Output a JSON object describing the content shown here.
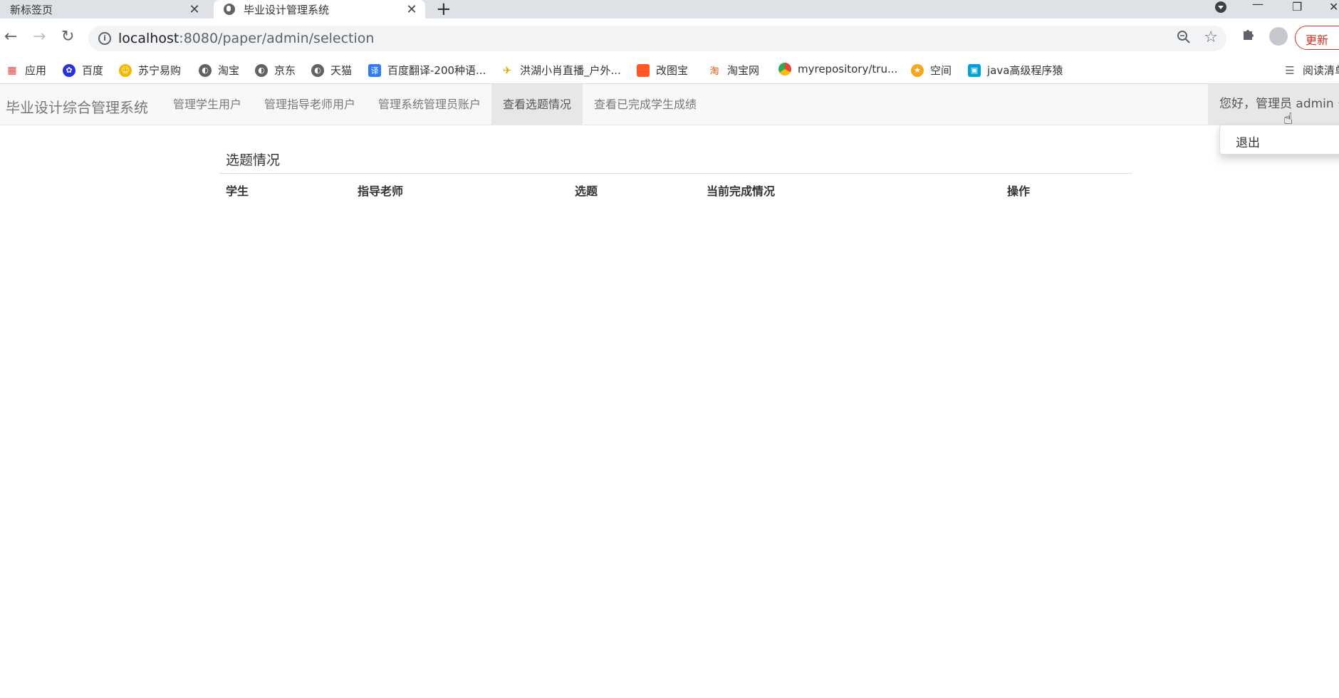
{
  "browser": {
    "tabs": [
      {
        "title": "新标签页",
        "active": false
      },
      {
        "title": "毕业设计管理系统",
        "active": true
      }
    ],
    "url_host": "localhost",
    "url_rest": ":8080/paper/admin/selection",
    "update_label": "更新",
    "bookmarks": [
      {
        "label": "应用",
        "icon": "apps-grid-icon",
        "color": "#e8453c"
      },
      {
        "label": "百度",
        "icon": "baidu-paw-icon",
        "color": "#2932e1"
      },
      {
        "label": "苏宁易购",
        "icon": "suning-icon",
        "color": "#f6b700"
      },
      {
        "label": "淘宝",
        "icon": "globe-icon",
        "color": "#5f6368"
      },
      {
        "label": "京东",
        "icon": "globe-icon",
        "color": "#5f6368"
      },
      {
        "label": "天猫",
        "icon": "globe-icon",
        "color": "#5f6368"
      },
      {
        "label": "百度翻译-200种语...",
        "icon": "baidu-translate-icon",
        "color": "#2f7bf6"
      },
      {
        "label": "洪湖小肖直播_户外...",
        "icon": "bird-icon",
        "color": "#e8a000"
      },
      {
        "label": "改图宝",
        "icon": "gaitubao-icon",
        "color": "#ff5722"
      },
      {
        "label": "淘宝网",
        "icon": "taobao-icon",
        "color": "#ff5000"
      },
      {
        "label": "myrepository/tru...",
        "icon": "chrome-icon",
        "color": "#34a853"
      },
      {
        "label": "空间",
        "icon": "qzone-icon",
        "color": "#f5a623"
      },
      {
        "label": "java高级程序猿",
        "icon": "bilibili-icon",
        "color": "#00a1d6"
      },
      {
        "label": "阅读清单",
        "icon": "reading-list-icon",
        "color": "#5f6368"
      }
    ]
  },
  "navbar": {
    "brand": "毕业设计综合管理系统",
    "links": [
      {
        "label": "管理学生用户",
        "active": false
      },
      {
        "label": "管理指导老师用户",
        "active": false
      },
      {
        "label": "管理系统管理员账户",
        "active": false
      },
      {
        "label": "查看选题情况",
        "active": true
      },
      {
        "label": "查看已完成学生成绩",
        "active": false
      }
    ],
    "user_greeting": "您好，管理员 admin",
    "dropdown_logout": "退出"
  },
  "main": {
    "title": "选题情况",
    "columns": [
      "学生",
      "指导老师",
      "选题",
      "当前完成情况",
      "操作"
    ],
    "rows": []
  }
}
